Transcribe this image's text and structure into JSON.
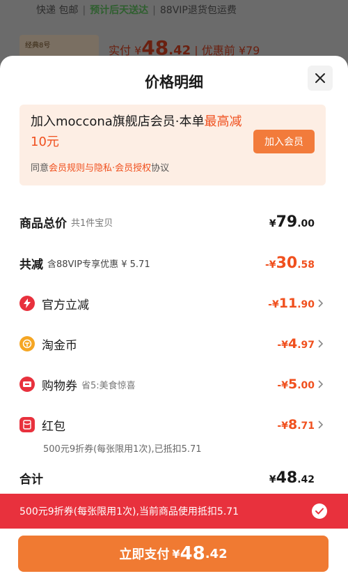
{
  "background": {
    "shipping": "快递 包邮",
    "delivery": "预计后天送达",
    "return_fee": "88VIP退货包运费",
    "thumb_text": "经典8号",
    "paid_label": "实付",
    "paid_symbol": "¥",
    "paid_int": "48",
    "paid_dec": ".42",
    "before_discount": "| 优惠前 ¥79"
  },
  "sheet": {
    "title": "价格明细",
    "close_icon": "close-icon"
  },
  "member": {
    "title_a": "加入moccona旗舰店会员·本单",
    "title_b": "最高减10元",
    "join_label": "加入会员",
    "agree_prefix": "同意",
    "agree_link": "会员规则与隐私·会员授权",
    "agree_suffix": "协议"
  },
  "total": {
    "label": "商品总价",
    "sub": "共1件宝贝",
    "symbol": "¥",
    "int": "79",
    "dec": ".00"
  },
  "reduction": {
    "label": "共减",
    "sub": "含88VIP专享优惠 ¥ 5.71",
    "symbol": "-¥",
    "int": "30",
    "dec": ".58"
  },
  "items": [
    {
      "label": "官方立减",
      "icon": "lightning-icon",
      "symbol": "-¥",
      "int": "11",
      "dec": ".90",
      "sub": ""
    },
    {
      "label": "淘金币",
      "icon": "coin-icon",
      "symbol": "-¥",
      "int": "4",
      "dec": ".97",
      "sub": ""
    },
    {
      "label": "购物券",
      "icon": "ticket-icon",
      "symbol": "-¥",
      "int": "5",
      "dec": ".00",
      "sub": "省5:美食惊喜"
    },
    {
      "label": "红包",
      "icon": "red-packet-icon",
      "symbol": "-¥",
      "int": "8",
      "dec": ".71",
      "sub": ""
    }
  ],
  "red_packet_note": "500元9折券(每张限用1次),已抵扣5.71",
  "sum": {
    "label": "合计",
    "symbol": "¥",
    "int": "48",
    "dec": ".42"
  },
  "coupon_bar": {
    "text": "500元9折券(每张限用1次),当前商品使用抵扣5.71",
    "check_icon": "check-icon"
  },
  "pay": {
    "label": "立即支付",
    "symbol": "¥",
    "int": "48",
    "dec": ".42"
  },
  "colors": {
    "accent": "#f0501e",
    "button": "#f07a32",
    "coupon_bar": "#e8313d"
  }
}
